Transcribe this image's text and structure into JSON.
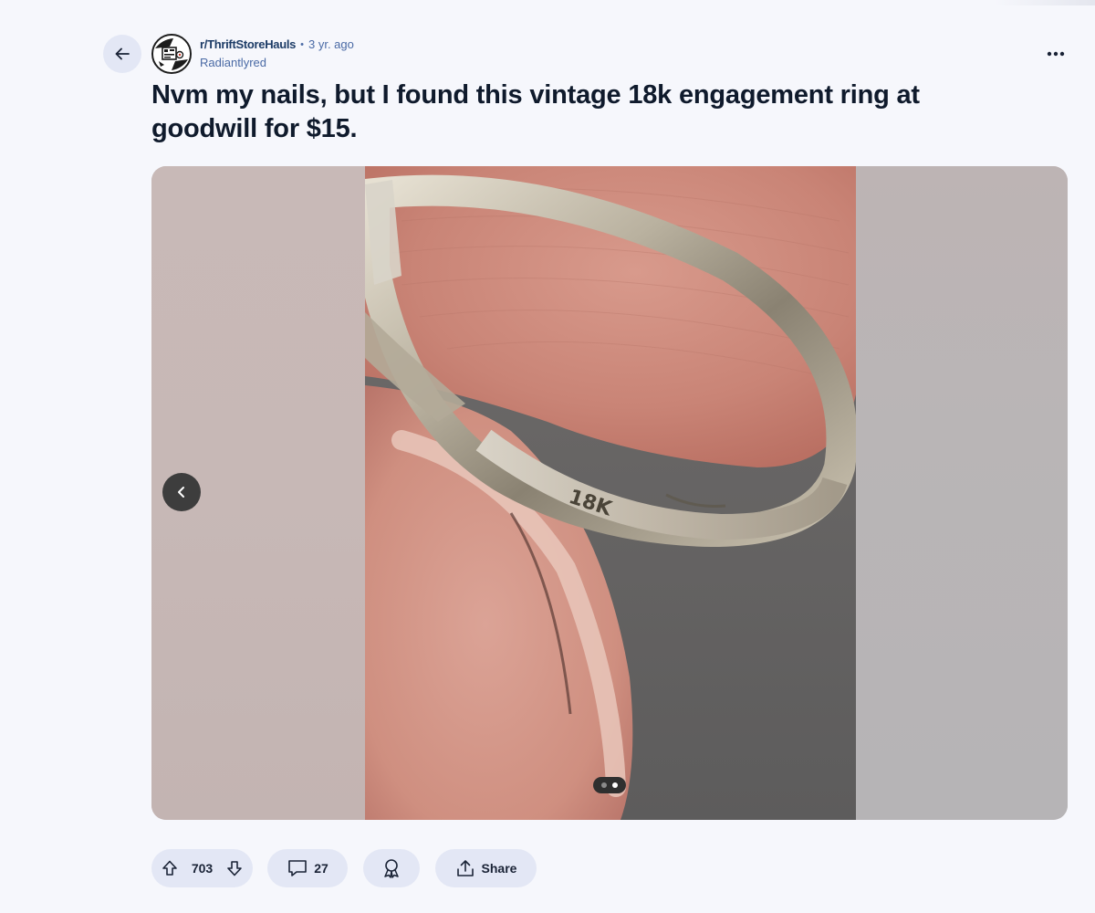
{
  "post": {
    "subreddit": "r/ThriftStoreHauls",
    "separator": "•",
    "age": "3 yr. ago",
    "author": "Radiantlyred",
    "title": "Nvm my nails, but I found this vintage 18k engagement ring at goodwill for $15."
  },
  "media": {
    "engraving_text": "18K",
    "carousel_total": 2,
    "carousel_current": 2
  },
  "actions": {
    "upvotes": "703",
    "comments": "27",
    "share_label": "Share"
  },
  "icons": {
    "back": "arrow-left-icon",
    "more": "more-horizontal-icon",
    "upvote": "upvote-arrow-icon",
    "downvote": "downvote-arrow-icon",
    "comment": "comment-bubble-icon",
    "award": "award-icon",
    "share": "share-upload-icon",
    "carousel_prev": "chevron-left-icon"
  },
  "colors": {
    "background": "#f6f7fc",
    "pill": "#e3e7f5",
    "meta_blue": "#4a6aa5"
  }
}
